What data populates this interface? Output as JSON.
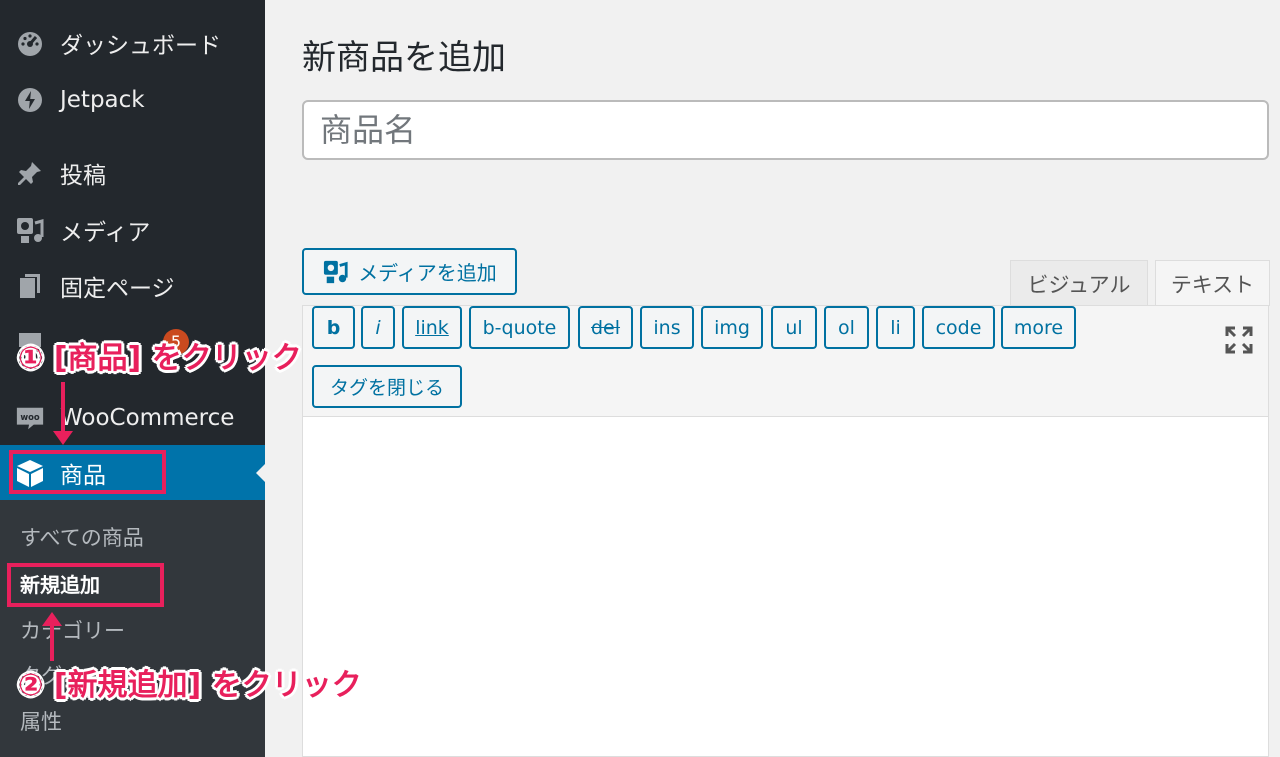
{
  "sidebar": {
    "items": [
      {
        "id": "dashboard",
        "label": "ダッシュボード",
        "icon": "dashboard-icon"
      },
      {
        "id": "jetpack",
        "label": "Jetpack",
        "icon": "jetpack-icon"
      },
      {
        "id": "posts",
        "label": "投稿",
        "icon": "pin-icon"
      },
      {
        "id": "media",
        "label": "メディア",
        "icon": "media-icon"
      },
      {
        "id": "pages",
        "label": "固定ページ",
        "icon": "pages-icon"
      },
      {
        "id": "woocommerce",
        "label": "WooCommerce",
        "icon": "woo-icon"
      },
      {
        "id": "products",
        "label": "商品",
        "icon": "box-icon"
      }
    ],
    "badge": "5",
    "woo_icon_text": "woo",
    "submenu": [
      {
        "label": "すべての商品"
      },
      {
        "label": "新規追加",
        "current": true
      },
      {
        "label": "カテゴリー"
      },
      {
        "label": "タグ"
      },
      {
        "label": "属性"
      }
    ]
  },
  "main": {
    "title": "新商品を追加",
    "title_placeholder": "商品名",
    "add_media_label": "メディアを追加",
    "tabs": {
      "visual": "ビジュアル",
      "text": "テキスト"
    },
    "quicktags": [
      "b",
      "i",
      "link",
      "b-quote",
      "del",
      "ins",
      "img",
      "ul",
      "ol",
      "li",
      "code",
      "more"
    ],
    "close_tags_label": "タグを閉じる"
  },
  "annotations": {
    "step1": "① [商品] をクリック",
    "step2": "② [新規追加] をクリック"
  },
  "colors": {
    "sidebar_bg": "#23282d",
    "submenu_bg": "#32373c",
    "active_blue": "#0073aa",
    "button_blue": "#0071a1",
    "annotation_pink": "#e8205c",
    "badge_orange": "#ca4a1f"
  }
}
